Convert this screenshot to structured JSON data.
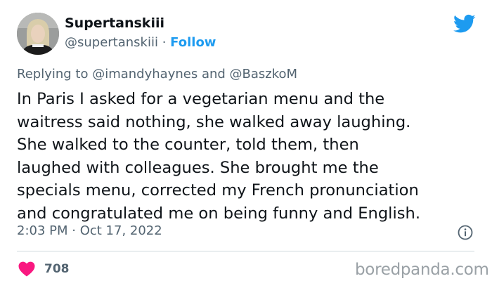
{
  "author": {
    "display_name": "Supertanskiii",
    "handle": "@supertanskiii",
    "separator": " · ",
    "follow_label": "Follow"
  },
  "reply": {
    "prefix": "Replying to ",
    "mention_1": "@imandyhaynes",
    "conjunction": " and ",
    "mention_2": "@BaszkoM"
  },
  "tweet": {
    "lines": [
      "In Paris I asked for a vegetarian menu and the",
      "waitress said nothing, she walked away laughing.",
      "She walked to the counter, told them, then",
      "laughed with colleagues. She brought me the",
      "specials menu, corrected my French pronunciation",
      "and congratulated me on being funny and English."
    ]
  },
  "meta": {
    "time": "2:03 PM",
    "separator": " · ",
    "date": "Oct 17, 2022"
  },
  "likes": {
    "count": "708"
  },
  "watermark": "boredpanda.com",
  "colors": {
    "twitter_blue": "#1d9bf0",
    "heart_red": "#f91880",
    "secondary_text": "#536471",
    "primary_text": "#0f1419"
  },
  "icons": [
    "twitter-bird-icon",
    "info-icon",
    "heart-icon"
  ]
}
